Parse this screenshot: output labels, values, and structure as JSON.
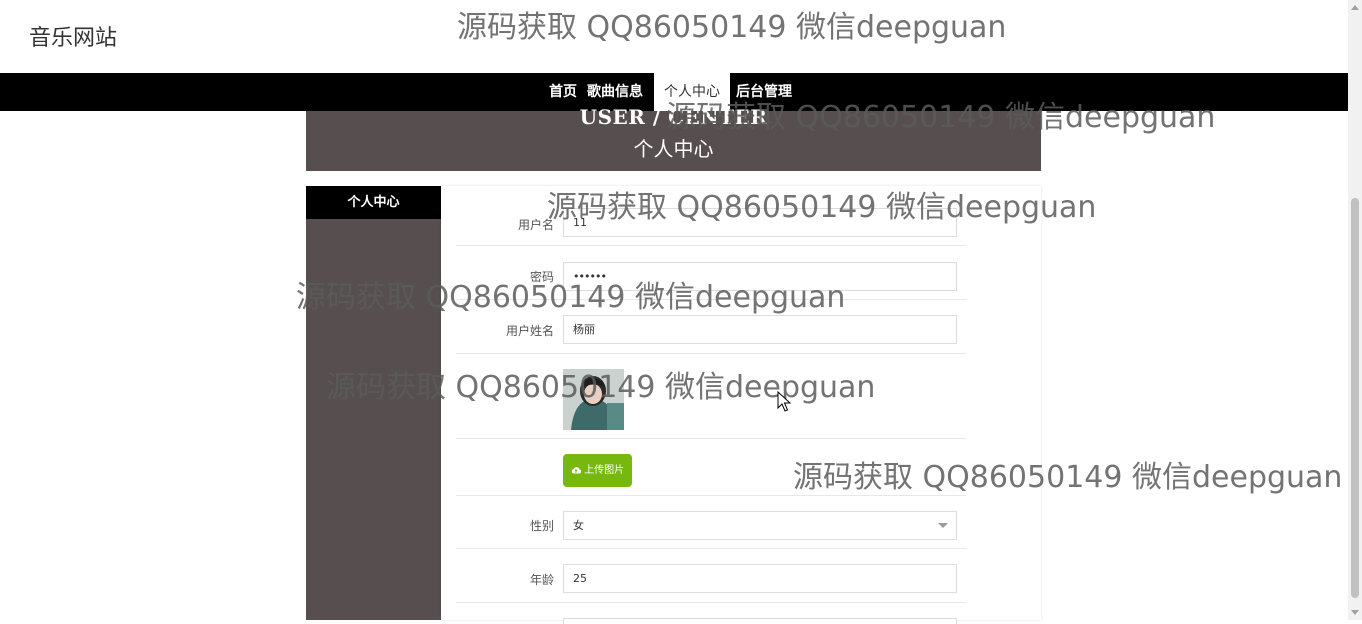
{
  "site": {
    "title": "音乐网站"
  },
  "nav": {
    "items": [
      {
        "label": "首页"
      },
      {
        "label": "歌曲信息"
      },
      {
        "label": "个人中心"
      },
      {
        "label": "后台管理"
      }
    ]
  },
  "banner": {
    "title_en": "USER / CENTER",
    "title_cn": "个人中心"
  },
  "sidebar": {
    "items": [
      {
        "label": "个人中心"
      }
    ]
  },
  "form": {
    "username": {
      "label": "用户名",
      "value": "11"
    },
    "password": {
      "label": "密码",
      "value": "••••••"
    },
    "realname": {
      "label": "用户姓名",
      "value": "杨丽"
    },
    "upload_label": "上传图片",
    "gender": {
      "label": "性别",
      "value": "女"
    },
    "age": {
      "label": "年龄",
      "value": "25"
    }
  },
  "watermark": {
    "text": "源码获取 QQ86050149 微信deepguan"
  },
  "colors": {
    "nav_bg": "#000000",
    "banner_bg": "#574f4f",
    "upload_button": "#76b80e"
  }
}
